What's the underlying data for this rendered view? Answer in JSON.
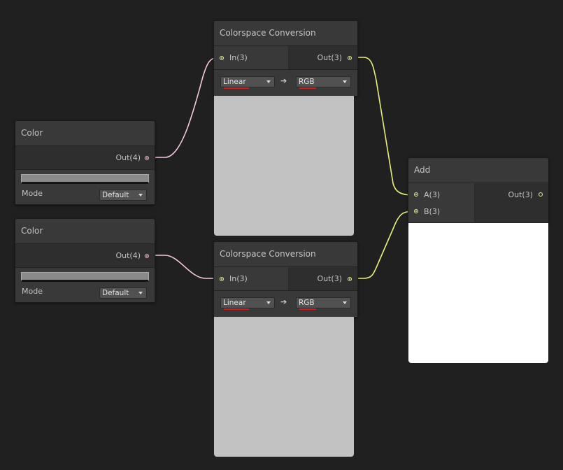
{
  "colors": {
    "canvas": "#202020",
    "node_body": "#393939",
    "port_yellow": "#e8ef9c",
    "port_pink": "#f3b7d9",
    "wire_yellow": "#e8ef7a",
    "wire_pink": "#f4c6df",
    "preview_grey": "#c2c2c2",
    "preview_white": "#ffffff",
    "annotation_red": "#d31a1a"
  },
  "color_node_1": {
    "title": "Color",
    "output": "Out(4)",
    "mode_label": "Mode",
    "mode_value": "Default"
  },
  "color_node_2": {
    "title": "Color",
    "output": "Out(4)",
    "mode_label": "Mode",
    "mode_value": "Default"
  },
  "conversion_1": {
    "title": "Colorspace Conversion",
    "input": "In(3)",
    "output": "Out(3)",
    "from": "Linear",
    "arrow": "➔",
    "to": "RGB"
  },
  "conversion_2": {
    "title": "Colorspace Conversion",
    "input": "In(3)",
    "output": "Out(3)",
    "from": "Linear",
    "arrow": "➔",
    "to": "RGB"
  },
  "add_node": {
    "title": "Add",
    "input_a": "A(3)",
    "input_b": "B(3)",
    "output": "Out(3)"
  }
}
